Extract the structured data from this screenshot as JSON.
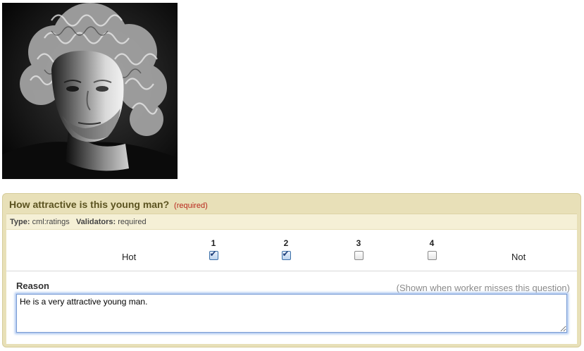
{
  "photo": {
    "alt": "Black and white portrait of a curly-haired young man"
  },
  "question": {
    "title": "How attractive is this young man?",
    "required_label": "(required)"
  },
  "meta": {
    "type_label": "Type:",
    "type_value": "cml:ratings",
    "validators_label": "Validators:",
    "validators_value": "required"
  },
  "ratings": {
    "low_label": "Hot",
    "high_label": "Not",
    "options": [
      {
        "number": "1",
        "checked": true
      },
      {
        "number": "2",
        "checked": true
      },
      {
        "number": "3",
        "checked": false
      },
      {
        "number": "4",
        "checked": false
      }
    ]
  },
  "reason": {
    "label": "Reason",
    "hint": "(Shown when worker misses this question)",
    "value": "He is a very attractive young man."
  },
  "colors": {
    "panel_bg": "#e8e0b8",
    "title_text": "#5b5320",
    "required_text": "#b8261c",
    "focus_ring": "#a9c4ef"
  }
}
